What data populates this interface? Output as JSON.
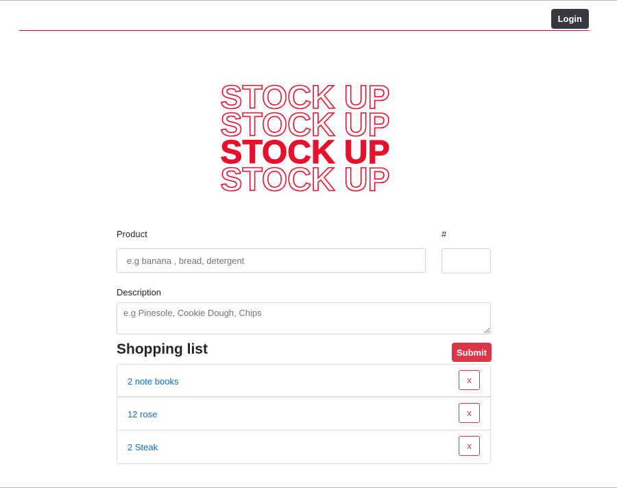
{
  "nav": {
    "login_label": "Login"
  },
  "logo": {
    "lines": [
      "STOCK UP",
      "STOCK UP",
      "STOCK UP",
      "STOCK UP"
    ],
    "filled_line_index": 2,
    "color": "#e8112d"
  },
  "form": {
    "product_label": "Product",
    "product_placeholder": "e.g banana , bread, detergent",
    "product_value": "",
    "quantity_label": "#",
    "quantity_value": "",
    "description_label": "Description",
    "description_placeholder": "e.g Pinesole, Cookie Dough, Chips",
    "description_value": ""
  },
  "list": {
    "title": "Shopping list",
    "submit_label": "Submit",
    "items": [
      {
        "text": "2 note books",
        "remove_label": "x"
      },
      {
        "text": "12 rose",
        "remove_label": "x"
      },
      {
        "text": "2 Steak",
        "remove_label": "x"
      }
    ]
  },
  "colors": {
    "accent_red": "#dc3545",
    "logo_red": "#e8112d",
    "nav_line": "#c8102e",
    "link_blue": "#0a6ed1",
    "dark_button": "#343a40"
  }
}
